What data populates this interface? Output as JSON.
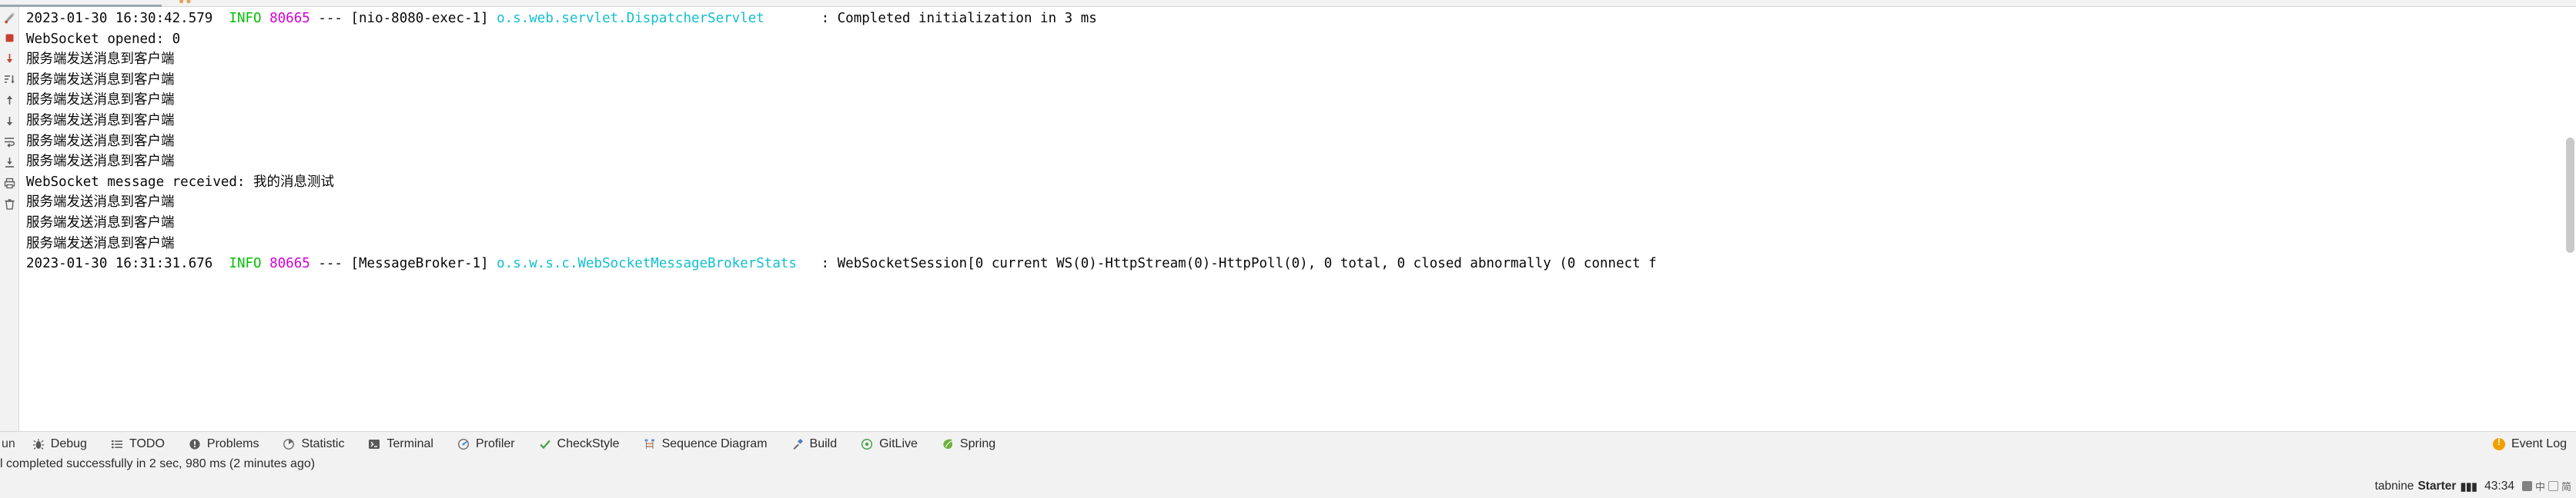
{
  "window": {
    "kind": "ide-run-console"
  },
  "colors": {
    "log_level": "#00c000",
    "log_pid": "#d400d4",
    "log_logger": "#11bfcf",
    "log_text": "#080808",
    "panel_bg": "#f2f2f2",
    "console_bg": "#ffffff",
    "tab_underline": "#9aa7b0",
    "event_badge": "#f0a000"
  },
  "gutter": {
    "buttons": [
      {
        "name": "rerun-icon",
        "label": "Rerun"
      },
      {
        "name": "stop-icon",
        "label": "Stop"
      },
      {
        "name": "arrow-down-red-icon",
        "label": "Next occurrence"
      },
      {
        "name": "sort-icon",
        "label": "Sort"
      },
      {
        "name": "arrow-up-icon",
        "label": "Previous"
      },
      {
        "name": "arrow-down-icon",
        "label": "Next"
      },
      {
        "name": "soft-wrap-icon",
        "label": "Soft-Wrap"
      },
      {
        "name": "export-icon",
        "label": "Export"
      },
      {
        "name": "print-icon",
        "label": "Print"
      },
      {
        "name": "trash-icon",
        "label": "Clear All"
      }
    ]
  },
  "console": {
    "lines": [
      {
        "type": "spring-log",
        "timestamp": "2023-01-30 16:30:42.579",
        "level": "INFO",
        "pid": "80665",
        "sep": "---",
        "thread": "[nio-8080-exec-1]",
        "logger": "o.s.web.servlet.DispatcherServlet",
        "logger_pad": "       ",
        "colon": ": ",
        "message": "Completed initialization in 3 ms"
      },
      {
        "type": "plain",
        "text": "WebSocket opened: 0"
      },
      {
        "type": "plain",
        "text": "服务端发送消息到客户端"
      },
      {
        "type": "plain",
        "text": "服务端发送消息到客户端"
      },
      {
        "type": "plain",
        "text": "服务端发送消息到客户端"
      },
      {
        "type": "plain",
        "text": "服务端发送消息到客户端"
      },
      {
        "type": "plain",
        "text": "服务端发送消息到客户端"
      },
      {
        "type": "plain",
        "text": "服务端发送消息到客户端"
      },
      {
        "type": "plain",
        "text": "WebSocket message received: 我的消息测试"
      },
      {
        "type": "plain",
        "text": "服务端发送消息到客户端"
      },
      {
        "type": "plain",
        "text": "服务端发送消息到客户端"
      },
      {
        "type": "plain",
        "text": "服务端发送消息到客户端"
      },
      {
        "type": "spring-log",
        "timestamp": "2023-01-30 16:31:31.676",
        "level": "INFO",
        "pid": "80665",
        "sep": "---",
        "thread": "[MessageBroker-1]",
        "logger": "o.s.w.s.c.WebSocketMessageBrokerStats",
        "logger_pad": "   ",
        "colon": ": ",
        "message": "WebSocketSession[0 current WS(0)-HttpStream(0)-HttpPoll(0), 0 total, 0 closed abnormally (0 connect f"
      }
    ]
  },
  "toolbar": {
    "run_label": "un",
    "items": [
      {
        "label": "Debug",
        "icon": "bug-icon"
      },
      {
        "label": "TODO",
        "icon": "list-icon"
      },
      {
        "label": "Problems",
        "icon": "exclamation-circle-icon"
      },
      {
        "label": "Statistic",
        "icon": "pie-chart-icon"
      },
      {
        "label": "Terminal",
        "icon": "terminal-icon"
      },
      {
        "label": "Profiler",
        "icon": "profiler-icon"
      },
      {
        "label": "CheckStyle",
        "icon": "checkmark-icon"
      },
      {
        "label": "Sequence Diagram",
        "icon": "sequence-diagram-icon"
      },
      {
        "label": "Build",
        "icon": "hammer-icon"
      },
      {
        "label": "GitLive",
        "icon": "gitlive-icon"
      },
      {
        "label": "Spring",
        "icon": "spring-leaf-icon"
      }
    ],
    "event_log": {
      "label": "Event Log",
      "icon": "event-log-icon"
    }
  },
  "status": {
    "message": "l completed successfully in 2 sec, 980 ms (2 minutes ago)",
    "tabnine": {
      "label": "tabnine",
      "starter": "Starter"
    },
    "clock": "43:34",
    "ime": {
      "primary": "中",
      "secondary": "简"
    }
  }
}
